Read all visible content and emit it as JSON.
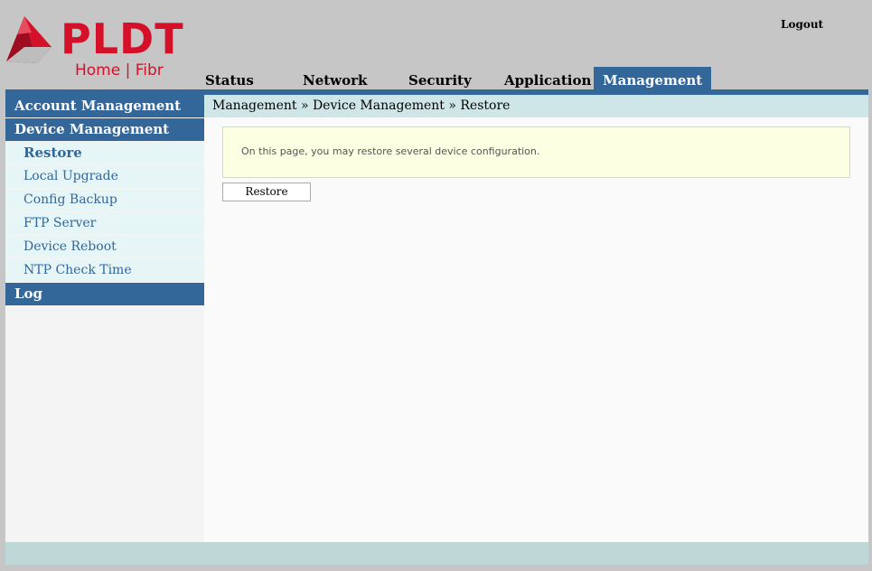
{
  "logo": {
    "wordmark": "PLDT",
    "sub": "Home | Fibr"
  },
  "header": {
    "logout": "Logout"
  },
  "tabs": [
    "Status",
    "Network",
    "Security",
    "Application",
    "Management"
  ],
  "sidebar": {
    "account_management": "Account Management",
    "device_management": "Device Management",
    "items": [
      "Restore",
      "Local Upgrade",
      "Config Backup",
      "FTP Server",
      "Device Reboot",
      "NTP Check Time"
    ],
    "log": "Log"
  },
  "breadcrumb": "Management » Device Management » Restore",
  "info_text": "On this page, you may restore several device configuration.",
  "restore_button": "Restore",
  "colors": {
    "brand_red": "#d5112a",
    "accent_blue": "#336699",
    "light_teal": "#e6f6f7"
  }
}
